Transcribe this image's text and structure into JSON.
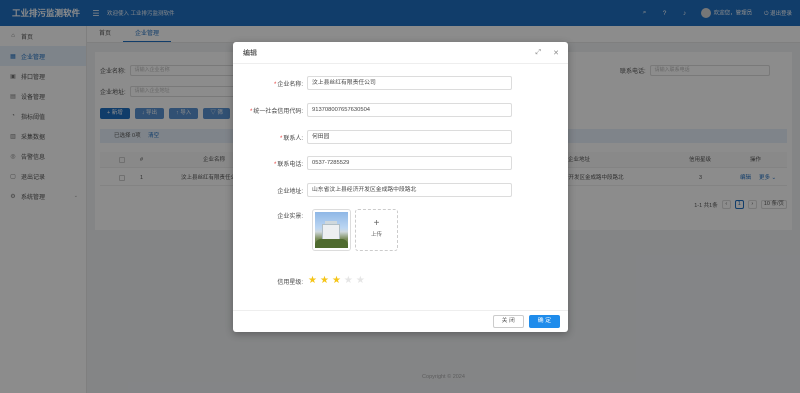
{
  "header": {
    "brand": "工业排污监测软件",
    "welcome": "欢迎使入 工业排污监测软件",
    "user_greeting": "欢迎您，管理员",
    "logout": "退出登录"
  },
  "sidebar": {
    "items": [
      {
        "label": "首页",
        "icon": "home-icon"
      },
      {
        "label": "企业管理",
        "icon": "building-icon"
      },
      {
        "label": "排口管理",
        "icon": "outlet-icon"
      },
      {
        "label": "设备管理",
        "icon": "device-icon"
      },
      {
        "label": "指标阈值",
        "icon": "gauge-icon"
      },
      {
        "label": "采集数据",
        "icon": "data-icon"
      },
      {
        "label": "告警信息",
        "icon": "bell-icon"
      },
      {
        "label": "退出记录",
        "icon": "record-icon"
      },
      {
        "label": "系统管理",
        "icon": "gear-icon"
      }
    ]
  },
  "tabs": [
    {
      "label": "首页"
    },
    {
      "label": "企业管理"
    }
  ],
  "filters": {
    "name_label": "企业名称:",
    "name_placeholder": "请输入企业名称",
    "address_label": "企业地址:",
    "address_placeholder": "请输入企业地址",
    "phone_label": "联系电话:",
    "phone_placeholder": "请输入联系电话"
  },
  "toolbar": {
    "add": "+ 新增",
    "export": "↓ 导出",
    "import": "↑ 导入",
    "filter": "▽ 筛"
  },
  "selection": {
    "text": "已选择 0项",
    "clear": "清空"
  },
  "table": {
    "headers": {
      "index": "#",
      "name": "企业名称",
      "address": "企业地址",
      "rating": "信用星级",
      "actions": "操作"
    },
    "rows": [
      {
        "index": "1",
        "name": "汶上县丝红有限责任公",
        "address": "济开发区金成路中段路北",
        "rating": "3",
        "edit": "编辑",
        "more": "更多"
      }
    ]
  },
  "pagination": {
    "summary": "1-1 共1条",
    "current": "1",
    "page_size": "10 条/页"
  },
  "footer": {
    "copyright": "Copyright © 2024"
  },
  "modal": {
    "title": "编辑",
    "fields": {
      "name_label": "企业名称:",
      "name_value": "汶上县丝红有限责任公司",
      "credit_code_label": "统一社会信用代码:",
      "credit_code_value": "91370800765763050​4",
      "contact_label": "联系人:",
      "contact_value": "何田园",
      "phone_label": "联系电话:",
      "phone_value": "0537-7285529",
      "address_label": "企业地址:",
      "address_value": "山东省汶上县经济开发区金成路中段路北",
      "photo_label": "企业实景:",
      "upload_label": "上传",
      "rating_label": "信用星级:"
    },
    "rating": {
      "value": 3,
      "max": 5
    },
    "buttons": {
      "close": "关 闭",
      "confirm": "确 定"
    }
  },
  "colors": {
    "brand": "#1f6fc2",
    "primary_button": "#1f8ceb",
    "star_on": "#f5c518"
  }
}
